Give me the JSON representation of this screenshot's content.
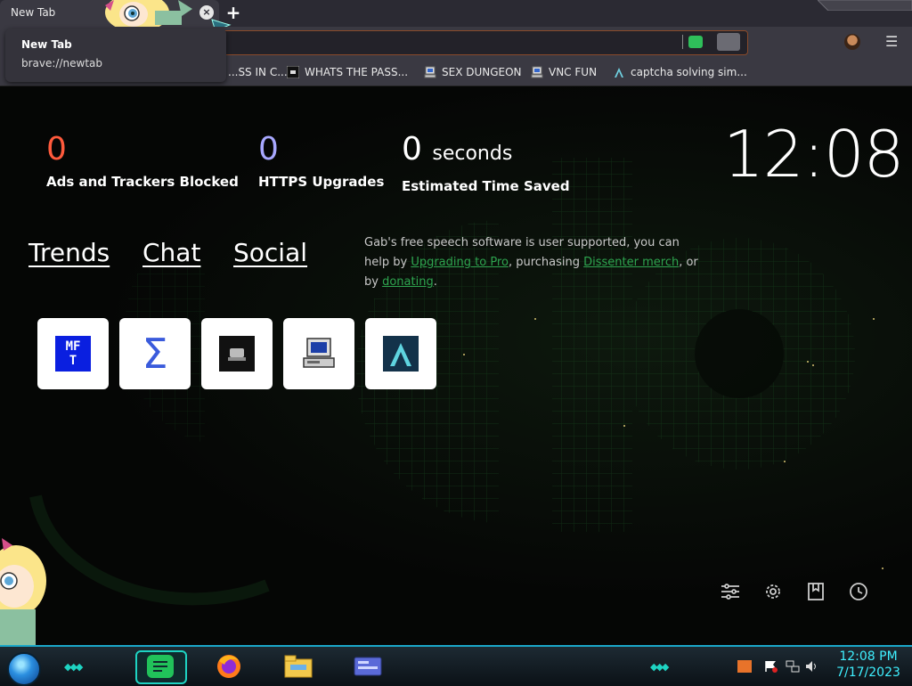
{
  "browser": {
    "tab_title": "New Tab",
    "tooltip": {
      "title": "New Tab",
      "url": "brave://newtab"
    },
    "new_tab_symbol": "+",
    "close_symbol": "×",
    "menu_symbol": "☰",
    "bookmarks": [
      {
        "label": "...SS IN C...",
        "icon": "bookmark-icon-generic"
      },
      {
        "label": "WHATS THE PASS...",
        "icon": "bookmark-icon-monitor"
      },
      {
        "label": "SEX DUNGEON",
        "icon": "bookmark-icon-computer"
      },
      {
        "label": "VNC FUN",
        "icon": "bookmark-icon-computer"
      },
      {
        "label": "captcha solving sim...",
        "icon": "bookmark-icon-arrow"
      }
    ]
  },
  "stats": {
    "ads": {
      "value": "0",
      "label": "Ads and Trackers Blocked",
      "color": "#ff5a3c"
    },
    "https": {
      "value": "0",
      "label": "HTTPS Upgrades",
      "color": "#a8a8ff"
    },
    "time": {
      "value": "0",
      "unit": "seconds",
      "label": "Estimated Time Saved",
      "color": "#ffffff"
    }
  },
  "clock": "12:08",
  "nav": {
    "trends": "Trends",
    "chat": "Chat",
    "social": "Social"
  },
  "gab_message": {
    "part1": "Gab's free speech software is user supported, you can help by ",
    "link1": "Upgrading to Pro",
    "part2": ", purchasing ",
    "link2": "Dissenter merch",
    "part3": ", or by ",
    "link3": "donating",
    "part4": "."
  },
  "tiles": [
    {
      "name": "mft",
      "text": "MF\nT"
    },
    {
      "name": "sigma",
      "text": "Σ"
    },
    {
      "name": "monitor"
    },
    {
      "name": "computer"
    },
    {
      "name": "captcha"
    }
  ],
  "taskbar": {
    "time": "12:08 PM",
    "date": "7/17/2023"
  },
  "colors": {
    "accent_green": "#2ea44f",
    "taskbar_cyan": "#1ed3c2",
    "clock_text": "#3ff0ff"
  }
}
